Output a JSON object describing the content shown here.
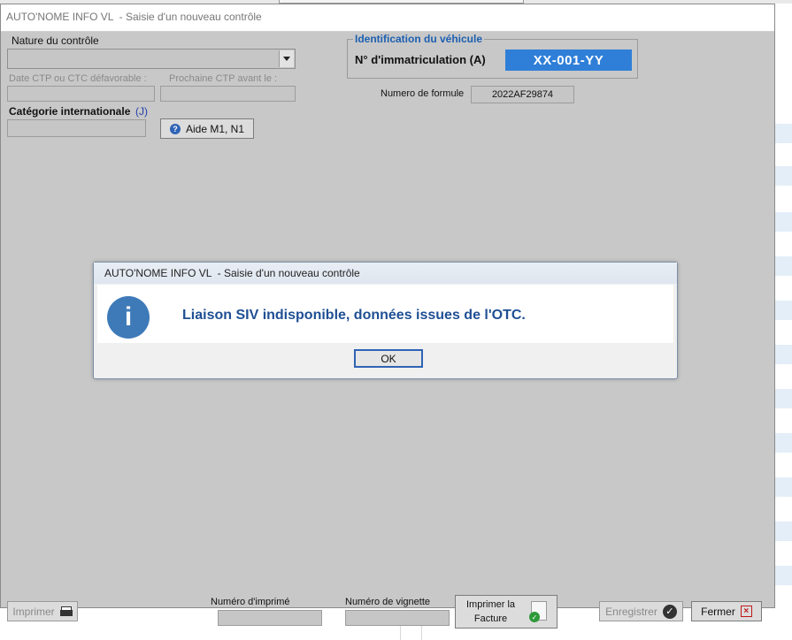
{
  "window": {
    "title": "AUTO'NOME INFO VL  - Saisie d'un nouveau contrôle"
  },
  "form": {
    "nature_label": "Nature du contrôle",
    "nature_value": "",
    "date_ctp_label": "Date CTP ou CTC défavorable :",
    "date_ctp_value": "",
    "prochaine_ctp_label": "Prochaine CTP avant le :",
    "prochaine_ctp_value": "",
    "categorie_label": "Catégorie internationale",
    "categorie_hint": "(J)",
    "categorie_value": "",
    "aide_button": "Aide M1, N1"
  },
  "vehicle": {
    "group_title": "Identification du véhicule",
    "immat_label": "N° d'immatriculation (A)",
    "immat_value": "XX-001-YY",
    "formule_label": "Numero de formule",
    "formule_value": "2022AF29874"
  },
  "dialog": {
    "title": "AUTO'NOME INFO VL  - Saisie d'un nouveau contrôle",
    "icon_text": "i",
    "message": "Liaison SIV indisponible, données issues de l'OTC.",
    "ok_label": "OK"
  },
  "footer": {
    "print_button": "Imprimer",
    "numero_imprime_label": "Numéro d'imprimé",
    "numero_imprime_value": "",
    "numero_vignette_label": "Numéro de vignette",
    "numero_vignette_value": "",
    "invoice_button_line1": "Imprimer la",
    "invoice_button_line2": "Facture",
    "save_button": "Enregistrer",
    "close_button": "Fermer"
  },
  "icons": {
    "print": "printer-icon",
    "save": "check-circle-icon",
    "close": "close-icon",
    "info": "info-icon",
    "help": "help-icon",
    "invoice": "invoice-icon"
  },
  "colors": {
    "plate_bg": "#2f7fd8",
    "group_title": "#1d5fb0",
    "dialog_message": "#1f4f94",
    "info_icon": "#3e7ab8"
  }
}
